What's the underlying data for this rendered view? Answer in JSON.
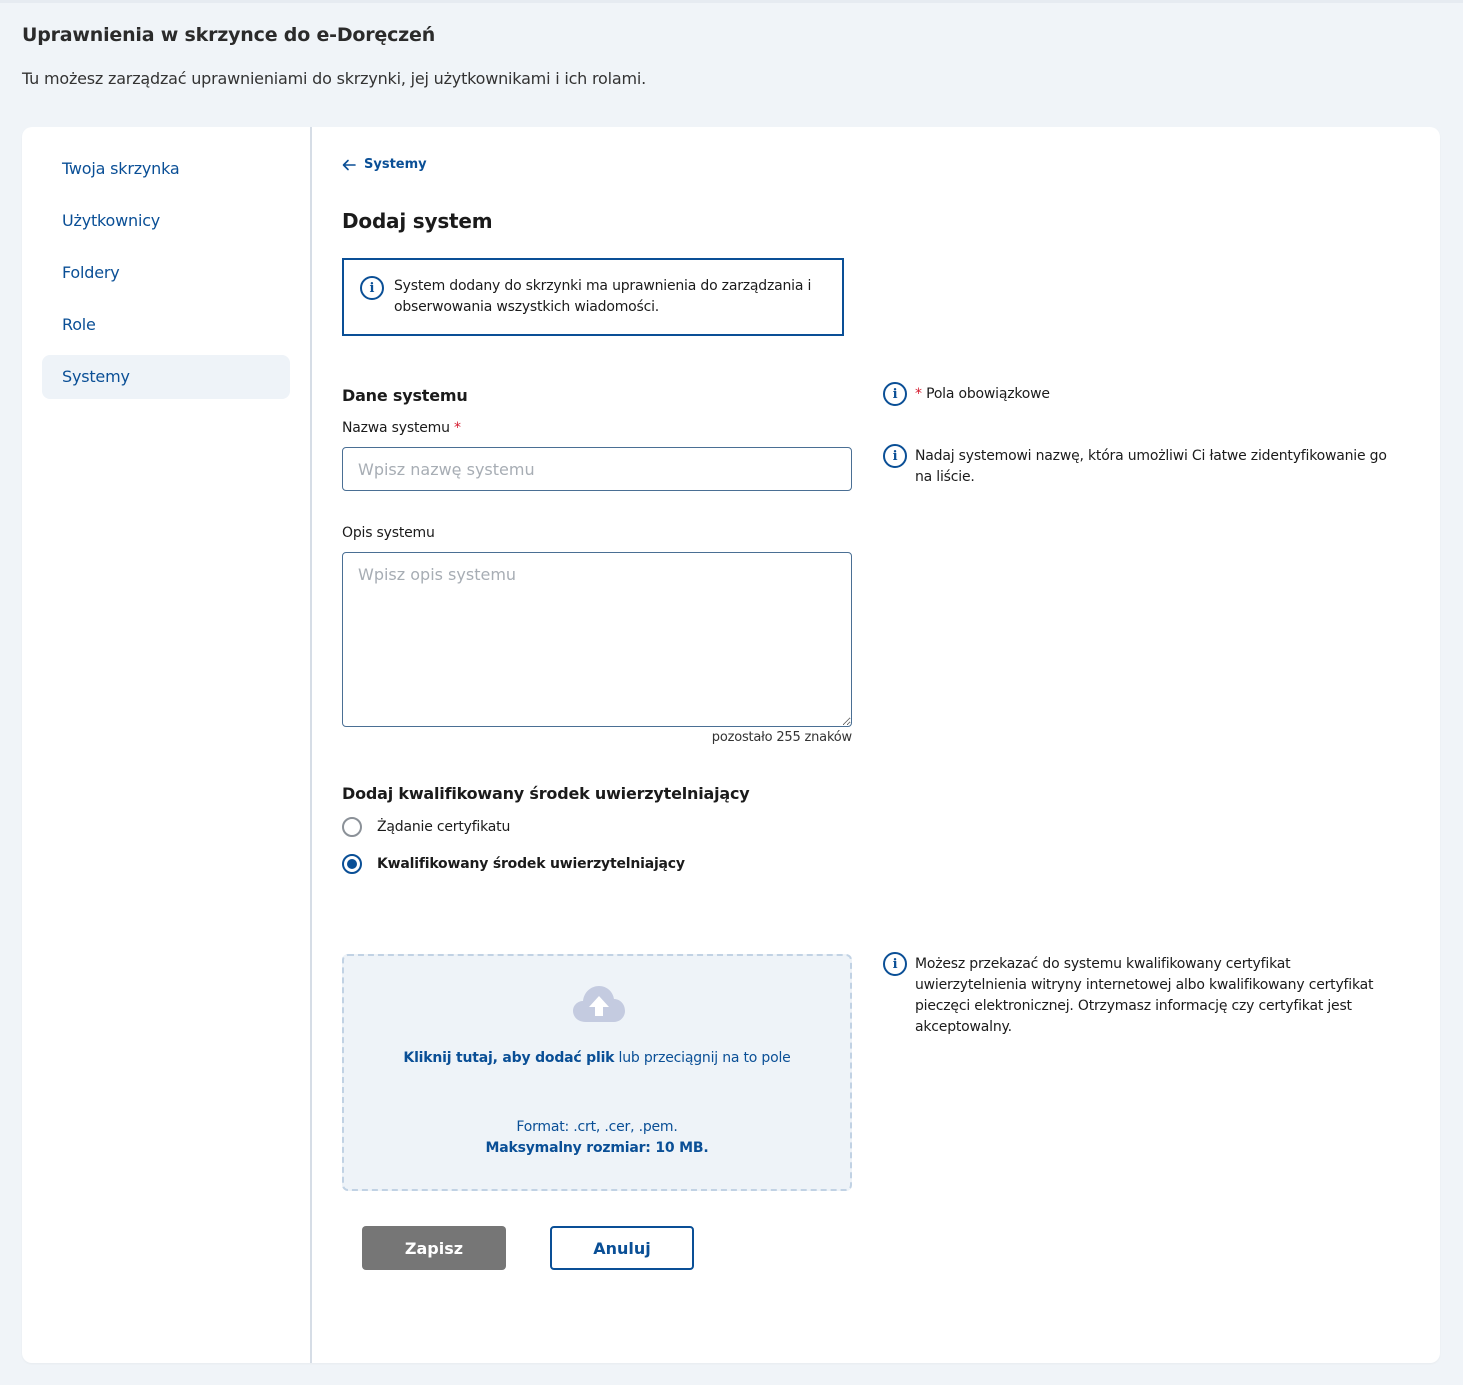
{
  "page": {
    "title": "Uprawnienia w skrzynce do e-Doręczeń",
    "description": "Tu możesz zarządzać uprawnieniami do skrzynki, jej użytkownikami i ich rolami."
  },
  "sidebar": {
    "items": [
      {
        "label": "Twoja skrzynka"
      },
      {
        "label": "Użytkownicy"
      },
      {
        "label": "Foldery"
      },
      {
        "label": "Role"
      },
      {
        "label": "Systemy",
        "active": true
      }
    ]
  },
  "main": {
    "back_label": "Systemy",
    "title": "Dodaj system",
    "alert_text": "System dodany do skrzynki ma uprawnienia do zarządzania i obserwowania wszystkich wiadomości.",
    "section_title": "Dane systemu",
    "required_note": "Pola obowiązkowe",
    "required_mark": "*",
    "name_field": {
      "label": "Nazwa systemu",
      "placeholder": "Wpisz nazwę systemu",
      "value": "",
      "hint": "Nadaj systemowi nazwę, która umożliwi Ci łatwe zidentyfikowanie go na liście."
    },
    "description_field": {
      "label": "Opis systemu",
      "placeholder": "Wpisz opis systemu",
      "value": "",
      "counter": "pozostało 255 znaków"
    },
    "auth": {
      "title": "Dodaj kwalifikowany środek uwierzytelniający",
      "options": [
        {
          "label": "Żądanie certyfikatu",
          "checked": false
        },
        {
          "label": "Kwalifikowany środek uwierzytelniający",
          "checked": true
        }
      ]
    },
    "upload": {
      "link_text": "Kliknij tutaj, aby dodać plik",
      "rest_text": " lub przeciągnij na to pole",
      "format": "Format: .crt, .cer, .pem.",
      "max_size": "Maksymalny rozmiar: 10 MB.",
      "hint": "Możesz przekazać do systemu kwalifikowany certyfikat uwierzytelnienia witryny internetowej albo kwalifikowany certyfikat pieczęci elektronicznej. Otrzymasz informację czy certyfikat jest akceptowalny.",
      "icon": "cloud-upload-icon"
    },
    "buttons": {
      "save": "Zapisz",
      "cancel": "Anuluj"
    }
  },
  "colors": {
    "accent": "#0a4f96",
    "required": "#d4192c",
    "save_disabled": "#767676"
  }
}
